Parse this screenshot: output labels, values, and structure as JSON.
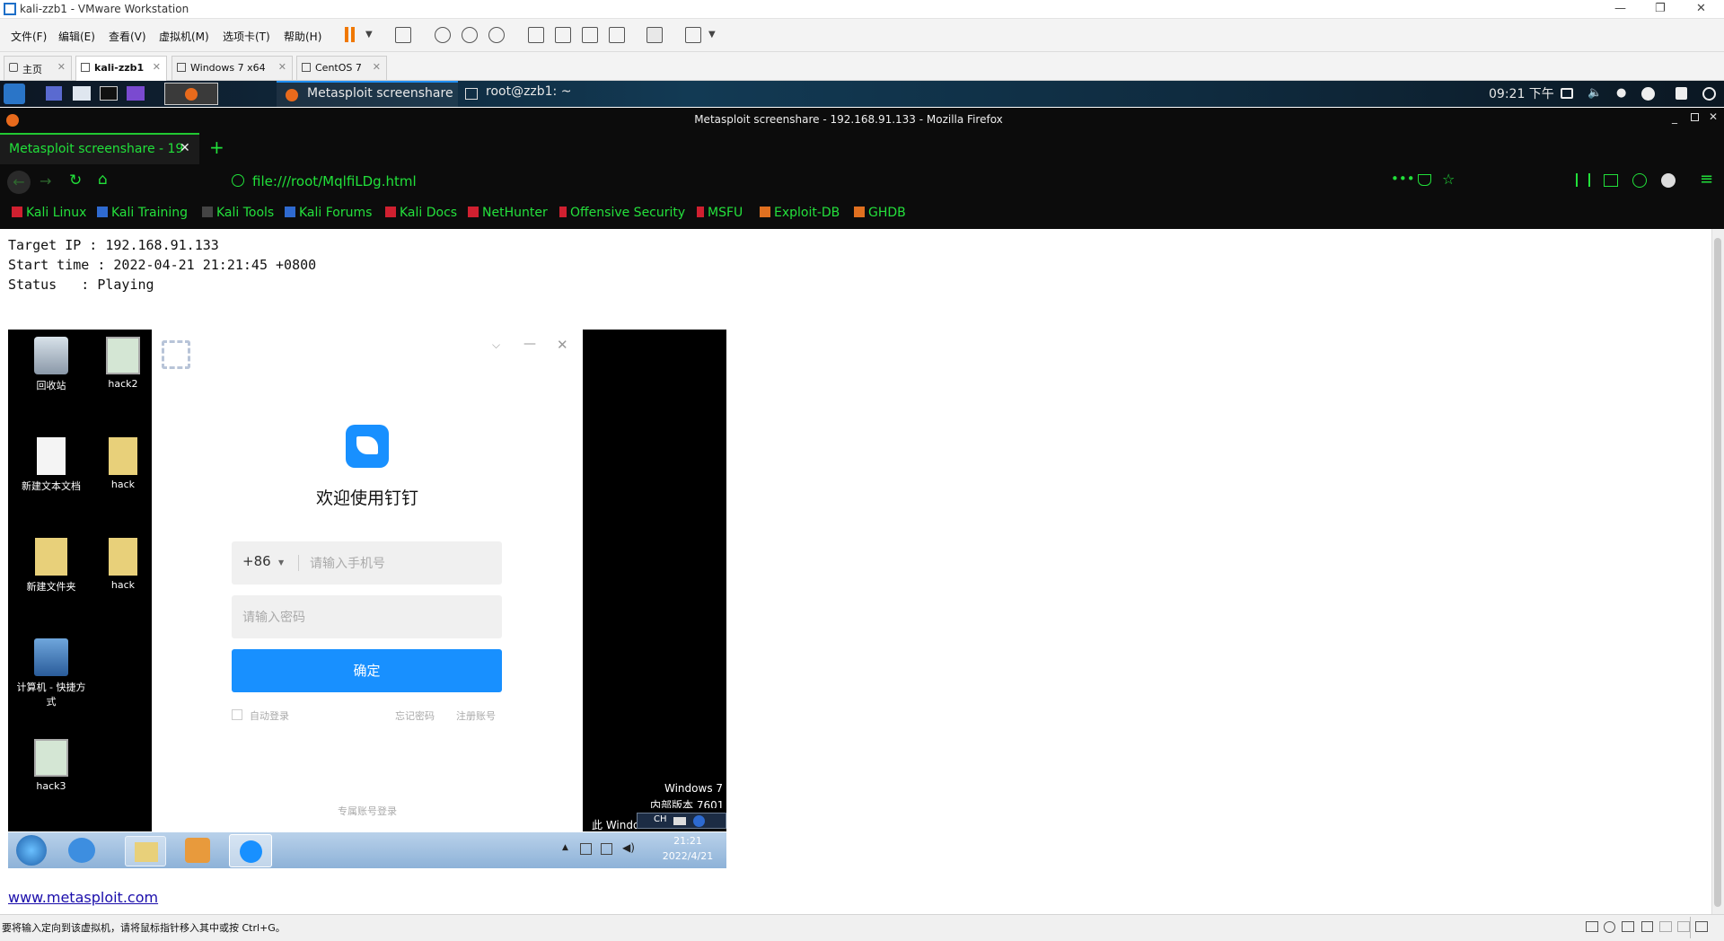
{
  "vm": {
    "title": "kali-zzb1 - VMware Workstation",
    "menu": [
      "文件(F)",
      "编辑(E)",
      "查看(V)",
      "虚拟机(M)",
      "选项卡(T)",
      "帮助(H)"
    ],
    "tabs": [
      {
        "label": "主页",
        "active": false
      },
      {
        "label": "kali-zzb1",
        "active": true
      },
      {
        "label": "Windows 7 x64",
        "active": false
      },
      {
        "label": "CentOS 7",
        "active": false
      }
    ],
    "status_text": "要将输入定向到该虚拟机，请将鼠标指针移入其中或按 Ctrl+G。"
  },
  "kali": {
    "task1": "Metasploit screenshare ...",
    "task2": "root@zzb1: ~",
    "clock": "09:21 下午"
  },
  "firefox": {
    "window_title": "Metasploit screenshare - 192.168.91.133 - Mozilla Firefox",
    "tab_label": "Metasploit screenshare - 19",
    "url": "file:///root/MqlfiLDg.html",
    "bookmarks": [
      "Kali Linux",
      "Kali Training",
      "Kali Tools",
      "Kali Forums",
      "Kali Docs",
      "NetHunter",
      "Offensive Security",
      "MSFU",
      "Exploit-DB",
      "GHDB"
    ]
  },
  "page": {
    "line1": "Target IP : 192.168.91.133",
    "line2": "Start time : 2022-04-21 21:21:45 +0800",
    "line3": "Status   : Playing",
    "link": "www.metasploit.com"
  },
  "win7": {
    "icons": [
      "回收站",
      "hack2",
      "新建文本文档",
      "hack",
      "新建文件夹",
      "hack",
      "计算机 - 快捷方式",
      "hack3"
    ],
    "watermark1": "Windows 7",
    "watermark2": "内部版本 7601",
    "watermark3": "此 Windo",
    "tray_ime": "CH",
    "time": "21:21",
    "date": "2022/4/21"
  },
  "dingtalk": {
    "welcome": "欢迎使用钉钉",
    "country_code": "+86",
    "phone_placeholder": "请输入手机号",
    "password_placeholder": "请输入密码",
    "confirm": "确定",
    "auto_login": "自动登录",
    "forgot": "忘记密码",
    "register": "注册账号",
    "exclusive_login": "专属账号登录"
  },
  "colors": {
    "kali_green": "#21e03a",
    "ding_blue": "#1890ff"
  }
}
